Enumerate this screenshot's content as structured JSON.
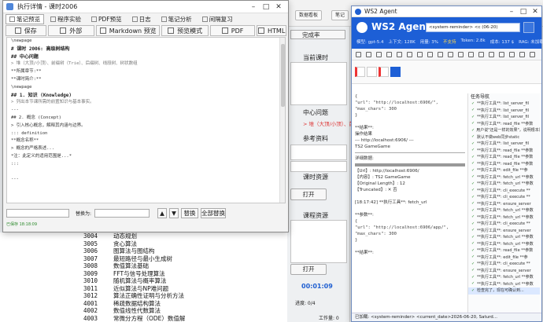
{
  "exec_window": {
    "title": "执行详情 - 课时2006",
    "tabs": [
      {
        "label": "笔记预览",
        "active": true
      },
      {
        "label": "程序实验",
        "active": false
      },
      {
        "label": "PDF预览",
        "active": false
      },
      {
        "label": "日志",
        "active": false
      },
      {
        "label": "笔记分析",
        "active": false
      },
      {
        "label": "间隔复习",
        "active": false
      }
    ],
    "toolbar": {
      "save": "保存",
      "external": "外部",
      "markdown_preview": "Markdown 预览",
      "preview_mode": "预览模式",
      "pdf": "PDF",
      "html": "HTML"
    },
    "content_lines": [
      {
        "text": "\\newpage",
        "style": ""
      },
      {
        "text": "# 课时 2006: 高级树结构",
        "style": "h"
      },
      {
        "text": "## 中心问题",
        "style": "h"
      },
      {
        "text": "> 堆（大顶/小顶）、前缀树（Trie）、后缀树、线段树、树状数组",
        "style": "q"
      },
      {
        "text": "**所属章节:**",
        "style": ""
      },
      {
        "text": "**课时简介:**",
        "style": ""
      },
      {
        "text": "\\newpage",
        "style": ""
      },
      {
        "text": "## 1. 知识 (Knowledge)",
        "style": "h"
      },
      {
        "text": "> 列出本节课所需的前置知识与基本事实。",
        "style": "q"
      },
      {
        "text": "---",
        "style": ""
      },
      {
        "text": "## 2. 概念 (Concept)",
        "style": ""
      },
      {
        "text": "> 引入核心概念，解释其内涵与边界。",
        "style": ""
      },
      {
        "text": "::: definition",
        "style": ""
      },
      {
        "text": "**概念名称**",
        "style": ""
      },
      {
        "text": "> 概念的严格表述...",
        "style": ""
      },
      {
        "text": "*注：此定义的适用范围是...*",
        "style": ""
      },
      {
        "text": ":::",
        "style": ""
      },
      {
        "text": "",
        "style": ""
      },
      {
        "text": "---",
        "style": ""
      },
      {
        "text": "",
        "style": ""
      },
      {
        "text": "",
        "style": ""
      }
    ],
    "search": {
      "replace_label": "替换为:",
      "replace_btn": "替换",
      "replace_all_btn": "全部替换",
      "up_arrow": "▲",
      "down_arrow": "▼"
    },
    "status": "已保存 18:18:09"
  },
  "background": {
    "top_buttons": [
      "数据看板",
      "笔记",
      "完成率"
    ],
    "current_lesson": "当前课时",
    "center_question": "中心问题",
    "reference": "参考资料",
    "lesson_resources": "课时资源",
    "course_resources": "课程资源",
    "open_btn": "打开",
    "time_label": "00:01:09",
    "progress": "进度: 0/4",
    "workload": "工作量: 0",
    "list_rows": [
      {
        "id": "3004",
        "name": "动态规划"
      },
      {
        "id": "3005",
        "name": "贪心算法"
      },
      {
        "id": "3006",
        "name": "图算法与图结构"
      },
      {
        "id": "3007",
        "name": "最短路径与最小生成树"
      },
      {
        "id": "3008",
        "name": "数值算法基础"
      },
      {
        "id": "3009",
        "name": "FFT与信号处理算法"
      },
      {
        "id": "3010",
        "name": "随机算法与概率算法"
      },
      {
        "id": "3011",
        "name": "近似算法与NP难问题"
      },
      {
        "id": "3012",
        "name": "算法正确性证明与分析方法"
      },
      {
        "id": "4001",
        "name": "稀疏数据结构算法"
      },
      {
        "id": "4002",
        "name": "数值线性代数算法"
      },
      {
        "id": "4003",
        "name": "常微分方程（ODE）数值解"
      },
      {
        "id": "4004",
        "name": "偏微分方程（PDE）数值解"
      }
    ]
  },
  "ws2": {
    "window_title": "WS2 Agent",
    "app_name": "WS2 Agent",
    "combo_value": "<system-reminder> <c (06-20)",
    "info": {
      "model": "模型: gpt-5.4",
      "context": "上下文: 128K",
      "usage": "用量: 3%",
      "status": "不支持",
      "tokens": "Token: 2.8k",
      "cost": "成本: 137 $",
      "rag": "RAG: 未加载"
    },
    "chat_lines": [
      {
        "text": "{",
        "kind": "code"
      },
      {
        "text": "  \"url\": \"http://localhost:6906/\",",
        "kind": "code"
      },
      {
        "text": "  \"max_chars\": 300",
        "kind": "code"
      },
      {
        "text": "}",
        "kind": "code"
      },
      {
        "text": "",
        "kind": ""
      },
      {
        "text": "**结果**:",
        "kind": ""
      },
      {
        "text": "操作结果",
        "kind": ""
      },
      {
        "text": "--- http://localhost:6906/ ---",
        "kind": ""
      },
      {
        "text": "TS2 GameGame",
        "kind": ""
      },
      {
        "text": "",
        "kind": "sep"
      },
      {
        "text": "详细数据:",
        "kind": ""
      },
      {
        "text": "",
        "kind": "divider"
      },
      {
        "text": "【Url】: http://localhost:6906/",
        "kind": ""
      },
      {
        "text": "【内容】: TS2 GameGame",
        "kind": ""
      },
      {
        "text": "【Original Length】: 12",
        "kind": ""
      },
      {
        "text": "【Truncated】: ✕ 否",
        "kind": ""
      },
      {
        "text": "",
        "kind": ""
      },
      {
        "text": "[18:17:42]  **执行工具**: fetch_url",
        "kind": ""
      },
      {
        "text": "",
        "kind": ""
      },
      {
        "text": "**参数**:",
        "kind": ""
      },
      {
        "text": "{",
        "kind": "code"
      },
      {
        "text": "  \"url\": \"http://localhost:6906/app/\",",
        "kind": "code"
      },
      {
        "text": "  \"max_chars\": 300",
        "kind": "code"
      },
      {
        "text": "}",
        "kind": "code"
      },
      {
        "text": "",
        "kind": ""
      },
      {
        "text": "**结果**:",
        "kind": ""
      }
    ],
    "side_title": "任务导航",
    "side_items": [
      "**执行工具**: list_server_fil",
      "**执行工具**: list_server_fil",
      "**执行工具**: list_server_fil",
      "**执行工具**: read_file **参数",
      "用户说\"还是一样的效果\"，说明根本原因",
      "默认不做web同步static",
      "**执行工具**: list_server_fil",
      "**执行工具**: read_file **参数",
      "**执行工具**: read_file **参数",
      "**执行工具**: read_file **参数",
      "**执行工具**: edit_file **参",
      "**执行工具**: fetch_url **参数",
      "**执行工具**: fetch_url **参数",
      "**执行工具**: cli_execute **",
      "**执行工具**: cli_execute **",
      "**执行工具**: ensure_server",
      "**执行工具**: fetch_url **参数",
      "**执行工具**: fetch_url **参数",
      "**执行工具**: cli_execute **",
      "**执行工具**: ensure_server",
      "**执行工具**: fetch_url **参数",
      "**执行工具**: fetch_url **参数",
      "**执行工具**: read_file **参数",
      "**执行工具**: edit_file **参",
      "**执行工具**: cli_execute **",
      "**执行工具**: ensure_server",
      "**执行工具**: fetch_url **参数",
      "**执行工具**: fetch_url **参数",
      "检查完了，现在可确认到..."
    ],
    "bottom_bar": "已加载: <system-reminder> <current_date>2026-06-20, Saturd..."
  }
}
